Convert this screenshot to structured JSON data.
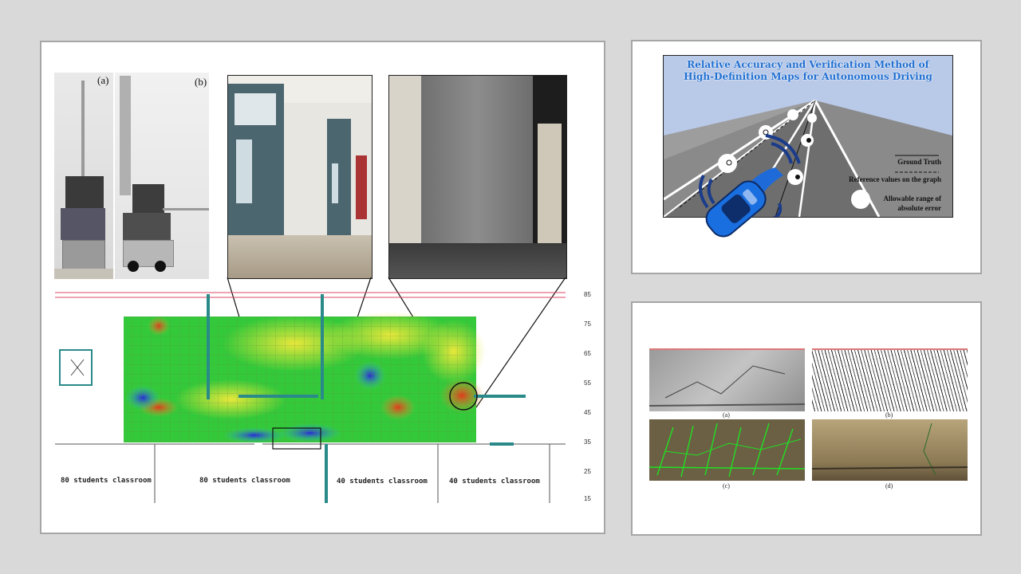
{
  "left_panel": {
    "robot_labels": [
      "(a)",
      "(b)"
    ],
    "room_labels": [
      "80 students classroom",
      "80 students classroom",
      "40 students classroom",
      "40 students classroom"
    ],
    "scale_ticks": [
      "85",
      "75",
      "65",
      "55",
      "45",
      "35",
      "25",
      "15"
    ]
  },
  "top_right_panel": {
    "title_line1": "Relative Accuracy and Verification Method of",
    "title_line2": "High-Definition Maps for Autonomous Driving",
    "legend_ground_truth": "Ground Truth",
    "legend_reference": "Reference values on the graph",
    "legend_allowable_1": "Allowable range of",
    "legend_allowable_2": "absolute error"
  },
  "bottom_right_panel": {
    "captions": [
      "(a)",
      "(b)",
      "(c)",
      "(d)"
    ]
  },
  "colors": {
    "background": "#d9d9d9",
    "panel_border": "#a6a6a6",
    "title_blue": "#1f6fd1",
    "heat_green": "#33cc33",
    "heat_yellow": "#e6e633",
    "heat_red": "#e03a1a",
    "heat_blue": "#2a2ad6"
  }
}
